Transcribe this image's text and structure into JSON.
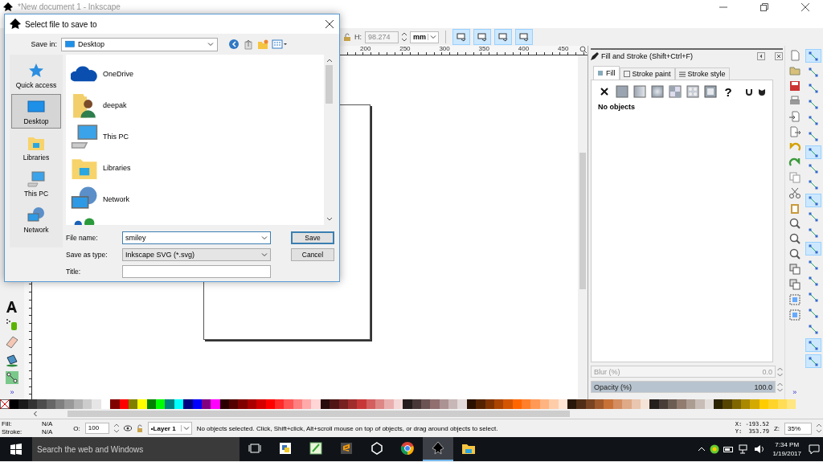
{
  "window": {
    "title": "*New document 1 - Inkscape"
  },
  "toolbar": {
    "h_label": "H:",
    "h_value": "98.274",
    "unit": "mm",
    "toggles": [
      {
        "on": true
      },
      {
        "on": true
      },
      {
        "on": true
      },
      {
        "on": true
      }
    ]
  },
  "ruler": {
    "labels": [
      "200",
      "250",
      "300",
      "350",
      "400",
      "450"
    ]
  },
  "toolbox": {
    "more": "»"
  },
  "commands": {
    "more": "»"
  },
  "snap": [
    {
      "on": true
    },
    {
      "on": false
    },
    {
      "on": false
    },
    {
      "on": false
    },
    {
      "on": false
    },
    {
      "on": false
    },
    {
      "on": true
    },
    {
      "on": false
    },
    {
      "on": false
    },
    {
      "on": true
    },
    {
      "on": false
    },
    {
      "on": false
    },
    {
      "on": true
    },
    {
      "on": false
    },
    {
      "on": false
    },
    {
      "on": false
    },
    {
      "on": false
    },
    {
      "on": false
    },
    {
      "on": true
    },
    {
      "on": true
    }
  ],
  "dock": {
    "title": "Fill and Stroke (Shift+Ctrl+F)",
    "tabs": [
      {
        "label": "Fill",
        "selected": true
      },
      {
        "label": "Stroke paint",
        "selected": false
      },
      {
        "label": "Stroke style",
        "selected": false
      }
    ],
    "paint_types": [
      {
        "kind": "none"
      },
      {
        "kind": "flat"
      },
      {
        "kind": "linear"
      },
      {
        "kind": "radial"
      },
      {
        "kind": "mesh"
      },
      {
        "kind": "pattern"
      },
      {
        "kind": "swatch"
      },
      {
        "kind": "unset",
        "label": "?"
      }
    ],
    "message": "No objects",
    "blur": {
      "label": "Blur (%)",
      "value": "0.0",
      "disabled": true
    },
    "opacity": {
      "label": "Opacity (%)",
      "value": "100.0",
      "disabled": false,
      "level": 1
    }
  },
  "palette": [
    {
      "color": "#000000"
    },
    {
      "color": "#1a1a1a"
    },
    {
      "color": "#333333"
    },
    {
      "color": "#4d4d4d"
    },
    {
      "color": "#666666"
    },
    {
      "color": "#808080"
    },
    {
      "color": "#999999"
    },
    {
      "color": "#b3b3b3"
    },
    {
      "color": "#cccccc"
    },
    {
      "color": "#e6e6e6"
    },
    {
      "color": "#ffffff"
    },
    {
      "color": "#800000"
    },
    {
      "color": "#ff0000"
    },
    {
      "color": "#808000"
    },
    {
      "color": "#ffff00"
    },
    {
      "color": "#008000"
    },
    {
      "color": "#00ff00"
    },
    {
      "color": "#008080"
    },
    {
      "color": "#00ffff"
    },
    {
      "color": "#000080"
    },
    {
      "color": "#0000ff"
    },
    {
      "color": "#800080"
    },
    {
      "color": "#ff00ff"
    },
    {
      "color": "#2b0000"
    },
    {
      "color": "#550000"
    },
    {
      "color": "#800000"
    },
    {
      "color": "#aa0000"
    },
    {
      "color": "#d40000"
    },
    {
      "color": "#ff0000"
    },
    {
      "color": "#ff2a2a"
    },
    {
      "color": "#ff5555"
    },
    {
      "color": "#ff8080"
    },
    {
      "color": "#ffaaaa"
    },
    {
      "color": "#ffd5d5"
    },
    {
      "color": "#280b0b"
    },
    {
      "color": "#501616"
    },
    {
      "color": "#782121"
    },
    {
      "color": "#a02c2c"
    },
    {
      "color": "#c83737"
    },
    {
      "color": "#d35f5f"
    },
    {
      "color": "#de8787"
    },
    {
      "color": "#e9afaf"
    },
    {
      "color": "#f4d7d7"
    },
    {
      "color": "#241c1c"
    },
    {
      "color": "#483737"
    },
    {
      "color": "#6c5353"
    },
    {
      "color": "#916f6f"
    },
    {
      "color": "#ac9393"
    },
    {
      "color": "#c8b7b7"
    },
    {
      "color": "#e3dbdb"
    },
    {
      "color": "#2b1100"
    },
    {
      "color": "#552200"
    },
    {
      "color": "#803300"
    },
    {
      "color": "#aa4400"
    },
    {
      "color": "#d45500"
    },
    {
      "color": "#ff6600"
    },
    {
      "color": "#ff7f2a"
    },
    {
      "color": "#ff9955"
    },
    {
      "color": "#ffb380"
    },
    {
      "color": "#ffccaa"
    },
    {
      "color": "#ffe6d5"
    },
    {
      "color": "#28170b"
    },
    {
      "color": "#502d16"
    },
    {
      "color": "#784421"
    },
    {
      "color": "#a05a2c"
    },
    {
      "color": "#c87137"
    },
    {
      "color": "#d38d5f"
    },
    {
      "color": "#deaa87"
    },
    {
      "color": "#e9c6af"
    },
    {
      "color": "#f4e3d7"
    },
    {
      "color": "#241f1c"
    },
    {
      "color": "#483e37"
    },
    {
      "color": "#6c5d53"
    },
    {
      "color": "#917c6f"
    },
    {
      "color": "#ac9d93"
    },
    {
      "color": "#c8beb7"
    },
    {
      "color": "#e3dedb"
    },
    {
      "color": "#2b2200"
    },
    {
      "color": "#554400"
    },
    {
      "color": "#806600"
    },
    {
      "color": "#aa8800"
    },
    {
      "color": "#d4aa00"
    },
    {
      "color": "#ffcc00"
    },
    {
      "color": "#ffd42a"
    },
    {
      "color": "#ffdd55"
    },
    {
      "color": "#ffe680"
    }
  ],
  "status": {
    "fill_label": "Fill:",
    "fill_value": "N/A",
    "stroke_label": "Stroke:",
    "stroke_value": "N/A",
    "opacity_label": "O:",
    "opacity_value": "100",
    "layer": "•Layer 1",
    "message": "No objects selected. Click, Shift+click, Alt+scroll mouse on top of objects, or drag around objects to select.",
    "x": "X: -193.52",
    "y": "Y:  353.79",
    "zoom_label": "Z:",
    "zoom_value": "35%"
  },
  "taskbar": {
    "search_placeholder": "Search the web and Windows",
    "apps": [
      {
        "kind": "python",
        "active": false
      },
      {
        "kind": "notepad",
        "active": false
      },
      {
        "kind": "sublime",
        "active": false
      },
      {
        "kind": "unity",
        "active": false
      },
      {
        "kind": "chrome",
        "active": false
      },
      {
        "kind": "inkscape",
        "active": true
      },
      {
        "kind": "explorer",
        "active": false
      }
    ],
    "time": "7:34 PM",
    "date": "1/19/2017"
  },
  "dialog": {
    "title": "Select file to save to",
    "save_in_label": "Save in:",
    "save_in_value": "Desktop",
    "places": [
      {
        "label": "Quick access",
        "kind": "star",
        "selected": false
      },
      {
        "label": "Desktop",
        "kind": "desktop",
        "selected": true
      },
      {
        "label": "Libraries",
        "kind": "libraries",
        "selected": false
      },
      {
        "label": "This PC",
        "kind": "pc",
        "selected": false
      },
      {
        "label": "Network",
        "kind": "network",
        "selected": false
      }
    ],
    "files": [
      {
        "name": "OneDrive",
        "kind": "cloud"
      },
      {
        "name": "deepak",
        "kind": "user"
      },
      {
        "name": "This PC",
        "kind": "pc"
      },
      {
        "name": "Libraries",
        "kind": "libraries"
      },
      {
        "name": "Network",
        "kind": "network"
      },
      {
        "kind": "homegroup"
      }
    ],
    "file_name_label": "File name:",
    "file_name": "smiley",
    "type_label": "Save as type:",
    "type_value": "Inkscape SVG (*.svg)",
    "title_label": "Title:",
    "buttons": [
      {
        "label": "Save",
        "kind": "default"
      },
      {
        "label": "Cancel",
        "kind": "normal"
      }
    ]
  }
}
